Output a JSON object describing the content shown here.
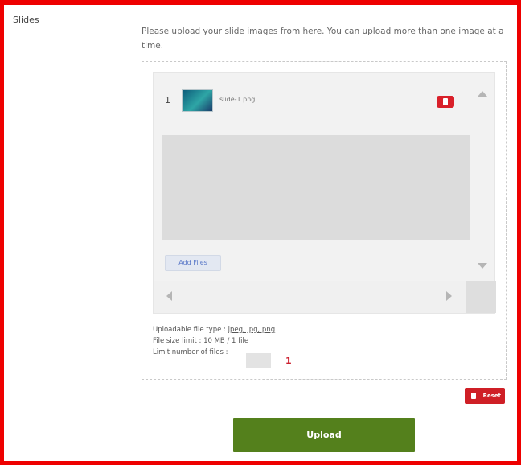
{
  "section": {
    "label": "Slides",
    "instructions": "Please upload your slide images from here. You can upload more than one image at a time."
  },
  "files": [
    {
      "index": "1",
      "name": "slide-1.png",
      "thumbnail_icon": "image-thumbnail"
    }
  ],
  "uploader": {
    "add_files_label": "Add Files",
    "delete_icon": "trash-icon",
    "scroll_icons": [
      "chevron-up-icon",
      "chevron-down-icon",
      "chevron-left-icon",
      "chevron-right-icon"
    ]
  },
  "limits": {
    "types_label": "Uploadable file type : ",
    "types_value": "jpeg, jpg, png",
    "size_label": "File size limit : 10 MB / 1 file",
    "count_label": "Limit number of files : ",
    "count_value": ""
  },
  "annotation_marker": "1",
  "buttons": {
    "reset_label": "Reset",
    "upload_label": "Upload"
  },
  "colors": {
    "frame": "#ee0000",
    "upload": "#54801c",
    "danger": "#cf1f26",
    "add_files": "#5a78c8"
  }
}
